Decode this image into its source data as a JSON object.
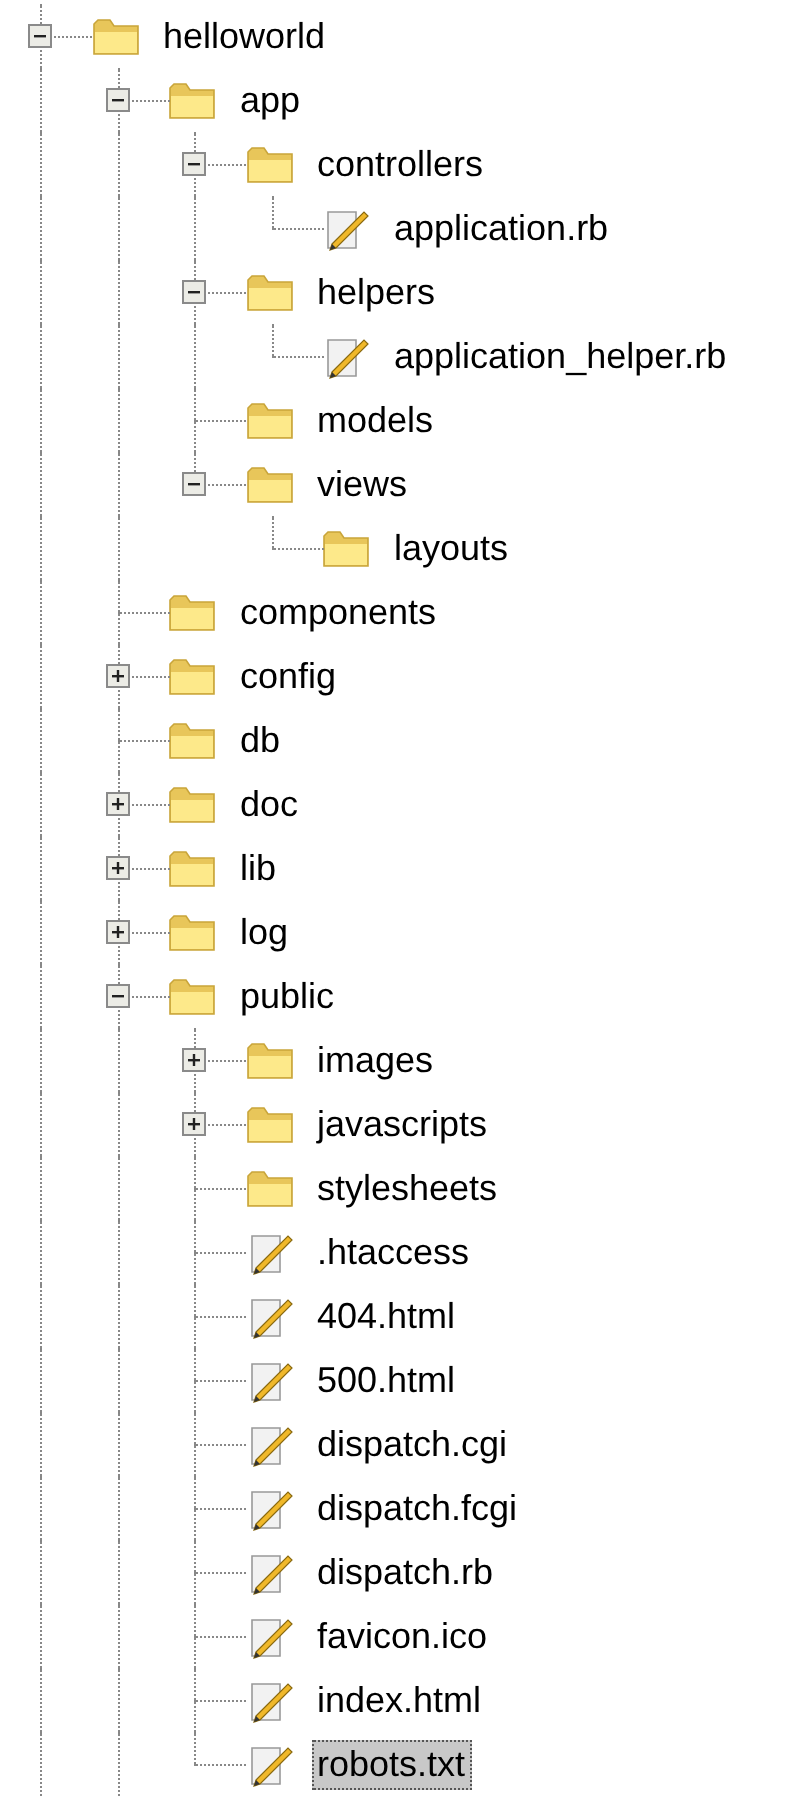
{
  "tree": {
    "continues": true,
    "items": [
      {
        "kind": "folder",
        "label": "helloworld",
        "expanded": true,
        "selected": false,
        "children_continue": true,
        "children": [
          {
            "kind": "folder",
            "label": "app",
            "expanded": true,
            "selected": false,
            "children": [
              {
                "kind": "folder",
                "label": "controllers",
                "expanded": true,
                "selected": false,
                "children": [
                  {
                    "kind": "file",
                    "label": "application.rb",
                    "selected": false
                  }
                ]
              },
              {
                "kind": "folder",
                "label": "helpers",
                "expanded": true,
                "selected": false,
                "children": [
                  {
                    "kind": "file",
                    "label": "application_helper.rb",
                    "selected": false
                  }
                ]
              },
              {
                "kind": "folder",
                "label": "models",
                "selected": false
              },
              {
                "kind": "folder",
                "label": "views",
                "expanded": true,
                "selected": false,
                "children": [
                  {
                    "kind": "folder",
                    "label": "layouts",
                    "selected": false
                  }
                ]
              }
            ]
          },
          {
            "kind": "folder",
            "label": "components",
            "selected": false
          },
          {
            "kind": "folder",
            "label": "config",
            "expanded": false,
            "selected": false
          },
          {
            "kind": "folder",
            "label": "db",
            "selected": false
          },
          {
            "kind": "folder",
            "label": "doc",
            "expanded": false,
            "selected": false
          },
          {
            "kind": "folder",
            "label": "lib",
            "expanded": false,
            "selected": false
          },
          {
            "kind": "folder",
            "label": "log",
            "expanded": false,
            "selected": false
          },
          {
            "kind": "folder",
            "label": "public",
            "expanded": true,
            "selected": false,
            "children": [
              {
                "kind": "folder",
                "label": "images",
                "expanded": false,
                "selected": false
              },
              {
                "kind": "folder",
                "label": "javascripts",
                "expanded": false,
                "selected": false
              },
              {
                "kind": "folder",
                "label": "stylesheets",
                "selected": false
              },
              {
                "kind": "file",
                "label": ".htaccess",
                "selected": false
              },
              {
                "kind": "file",
                "label": "404.html",
                "selected": false
              },
              {
                "kind": "file",
                "label": "500.html",
                "selected": false
              },
              {
                "kind": "file",
                "label": "dispatch.cgi",
                "selected": false
              },
              {
                "kind": "file",
                "label": "dispatch.fcgi",
                "selected": false
              },
              {
                "kind": "file",
                "label": "dispatch.rb",
                "selected": false
              },
              {
                "kind": "file",
                "label": "favicon.ico",
                "selected": false
              },
              {
                "kind": "file",
                "label": "index.html",
                "selected": false
              },
              {
                "kind": "file",
                "label": "robots.txt",
                "selected": true
              }
            ]
          }
        ]
      }
    ]
  }
}
